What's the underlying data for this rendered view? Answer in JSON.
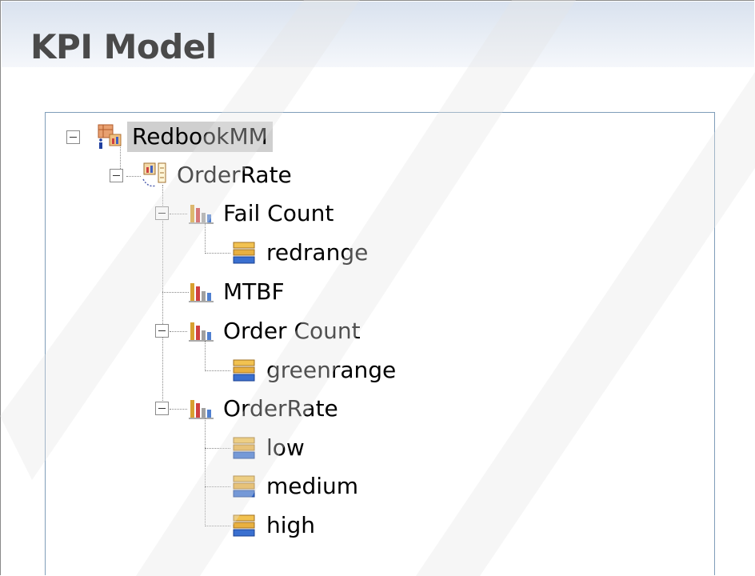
{
  "panel": {
    "title": "KPI Model"
  },
  "tree": {
    "root": {
      "label": "RedbookMM",
      "icon": "model-icon"
    },
    "context": {
      "label": "OrderRate",
      "icon": "kpi-context-icon"
    },
    "kpis": [
      {
        "label": "Fail Count",
        "icon": "kpi-icon",
        "ranges": [
          "redrange"
        ]
      },
      {
        "label": "MTBF",
        "icon": "kpi-icon",
        "ranges": []
      },
      {
        "label": "Order Count",
        "icon": "kpi-icon",
        "ranges": [
          "greenrange"
        ]
      },
      {
        "label": "OrderRate",
        "icon": "kpi-icon",
        "ranges": [
          "low",
          "medium",
          "high"
        ]
      }
    ]
  },
  "colors": {
    "selection": "#cfcfcf",
    "border": "#7f9db9"
  }
}
